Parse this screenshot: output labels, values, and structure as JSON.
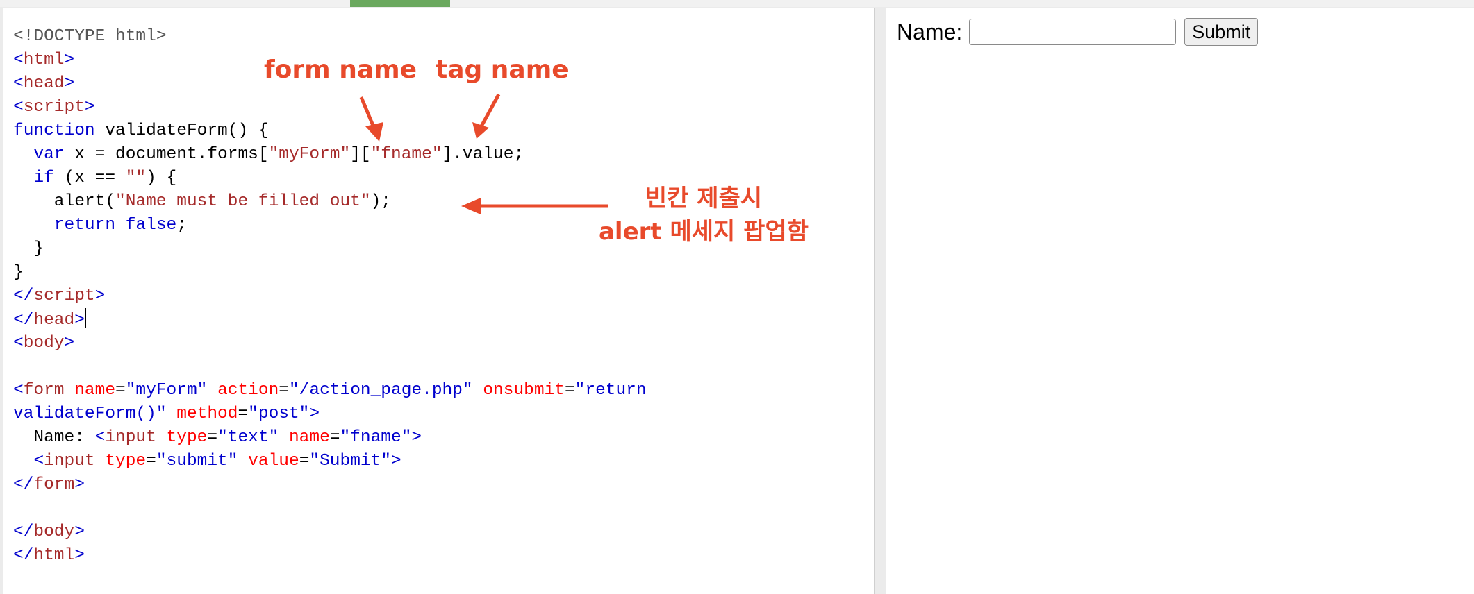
{
  "code_lines": [
    [
      {
        "t": "<!DOCTYPE html>",
        "c": "t-doc"
      }
    ],
    [
      {
        "t": "<",
        "c": "t-br"
      },
      {
        "t": "html",
        "c": "t-tag"
      },
      {
        "t": ">",
        "c": "t-br"
      }
    ],
    [
      {
        "t": "<",
        "c": "t-br"
      },
      {
        "t": "head",
        "c": "t-tag"
      },
      {
        "t": ">",
        "c": "t-br"
      }
    ],
    [
      {
        "t": "<",
        "c": "t-br"
      },
      {
        "t": "script",
        "c": "t-tag"
      },
      {
        "t": ">",
        "c": "t-br"
      }
    ],
    [
      {
        "t": "function",
        "c": "t-kw"
      },
      {
        "t": " validateForm() {"
      }
    ],
    [
      {
        "t": "  "
      },
      {
        "t": "var",
        "c": "t-kw"
      },
      {
        "t": " x = document.forms["
      },
      {
        "t": "\"myForm\"",
        "c": "t-str"
      },
      {
        "t": "]["
      },
      {
        "t": "\"fname\"",
        "c": "t-str"
      },
      {
        "t": "].value;"
      }
    ],
    [
      {
        "t": "  "
      },
      {
        "t": "if",
        "c": "t-kw"
      },
      {
        "t": " (x == "
      },
      {
        "t": "\"\"",
        "c": "t-str"
      },
      {
        "t": ") {"
      }
    ],
    [
      {
        "t": "    alert("
      },
      {
        "t": "\"Name must be filled out\"",
        "c": "t-str"
      },
      {
        "t": ");"
      }
    ],
    [
      {
        "t": "    "
      },
      {
        "t": "return",
        "c": "t-kw"
      },
      {
        "t": " "
      },
      {
        "t": "false",
        "c": "t-kw"
      },
      {
        "t": ";"
      }
    ],
    [
      {
        "t": "  }"
      }
    ],
    [
      {
        "t": "}"
      }
    ],
    [
      {
        "t": "</",
        "c": "t-br"
      },
      {
        "t": "script",
        "c": "t-tag"
      },
      {
        "t": ">",
        "c": "t-br"
      }
    ],
    [
      {
        "t": "</",
        "c": "t-br"
      },
      {
        "t": "head",
        "c": "t-tag"
      },
      {
        "t": ">",
        "c": "t-br"
      },
      {
        "caret": true
      }
    ],
    [
      {
        "t": "<",
        "c": "t-br"
      },
      {
        "t": "body",
        "c": "t-tag"
      },
      {
        "t": ">",
        "c": "t-br"
      }
    ],
    [],
    [
      {
        "t": "<",
        "c": "t-br"
      },
      {
        "t": "form",
        "c": "t-tag"
      },
      {
        "t": " "
      },
      {
        "t": "name",
        "c": "t-attr"
      },
      {
        "t": "="
      },
      {
        "t": "\"myForm\"",
        "c": "t-val"
      },
      {
        "t": " "
      },
      {
        "t": "action",
        "c": "t-attr"
      },
      {
        "t": "="
      },
      {
        "t": "\"/action_page.php\"",
        "c": "t-val"
      },
      {
        "t": " "
      },
      {
        "t": "onsubmit",
        "c": "t-attr"
      },
      {
        "t": "="
      },
      {
        "t": "\"return",
        "c": "t-val"
      }
    ],
    [
      {
        "t": "validateForm()\"",
        "c": "t-val"
      },
      {
        "t": " "
      },
      {
        "t": "method",
        "c": "t-attr"
      },
      {
        "t": "="
      },
      {
        "t": "\"post\"",
        "c": "t-val"
      },
      {
        "t": ">",
        "c": "t-br"
      }
    ],
    [
      {
        "t": "  Name: "
      },
      {
        "t": "<",
        "c": "t-br"
      },
      {
        "t": "input",
        "c": "t-tag"
      },
      {
        "t": " "
      },
      {
        "t": "type",
        "c": "t-attr"
      },
      {
        "t": "="
      },
      {
        "t": "\"text\"",
        "c": "t-val"
      },
      {
        "t": " "
      },
      {
        "t": "name",
        "c": "t-attr"
      },
      {
        "t": "="
      },
      {
        "t": "\"fname\"",
        "c": "t-val"
      },
      {
        "t": ">",
        "c": "t-br"
      }
    ],
    [
      {
        "t": "  "
      },
      {
        "t": "<",
        "c": "t-br"
      },
      {
        "t": "input",
        "c": "t-tag"
      },
      {
        "t": " "
      },
      {
        "t": "type",
        "c": "t-attr"
      },
      {
        "t": "="
      },
      {
        "t": "\"submit\"",
        "c": "t-val"
      },
      {
        "t": " "
      },
      {
        "t": "value",
        "c": "t-attr"
      },
      {
        "t": "="
      },
      {
        "t": "\"Submit\"",
        "c": "t-val"
      },
      {
        "t": ">",
        "c": "t-br"
      }
    ],
    [
      {
        "t": "</",
        "c": "t-br"
      },
      {
        "t": "form",
        "c": "t-tag"
      },
      {
        "t": ">",
        "c": "t-br"
      }
    ],
    [],
    [
      {
        "t": "</",
        "c": "t-br"
      },
      {
        "t": "body",
        "c": "t-tag"
      },
      {
        "t": ">",
        "c": "t-br"
      }
    ],
    [
      {
        "t": "</",
        "c": "t-br"
      },
      {
        "t": "html",
        "c": "t-tag"
      },
      {
        "t": ">",
        "c": "t-br"
      }
    ]
  ],
  "annotations": {
    "form_name": "form name",
    "tag_name": "tag name",
    "alert_line1": "빈칸 제출시",
    "alert_line2": "alert 메세지 팝업함"
  },
  "result": {
    "name_label": "Name:",
    "name_value": "",
    "submit_label": "Submit"
  },
  "colors": {
    "annotation": "#e84a2b",
    "tag": "#a52a2a",
    "bracket": "#0000cd",
    "attribute": "#ff0000",
    "value": "#0000cd",
    "indicator": "#6aa85e"
  }
}
